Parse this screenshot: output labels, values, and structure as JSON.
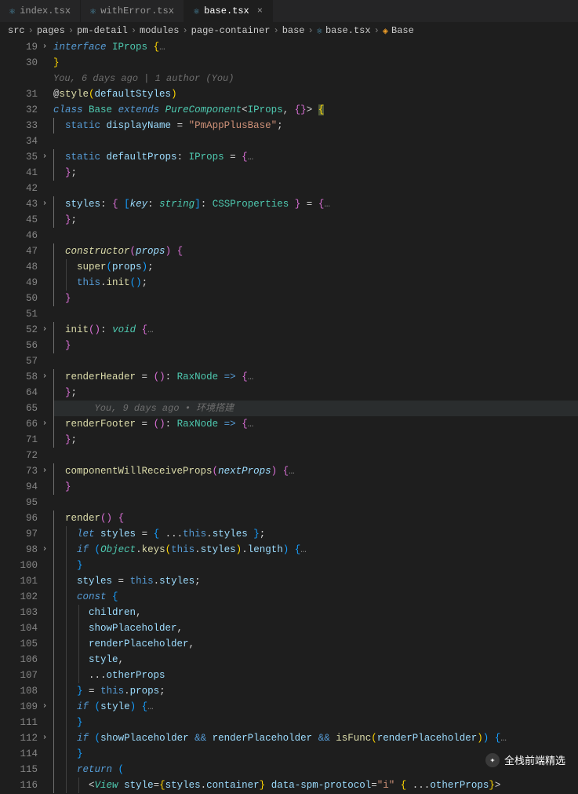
{
  "tabs": [
    {
      "label": "index.tsx",
      "active": false
    },
    {
      "label": "withError.tsx",
      "active": false
    },
    {
      "label": "base.tsx",
      "active": true
    }
  ],
  "breadcrumbs": {
    "parts": [
      "src",
      "pages",
      "pm-detail",
      "modules",
      "page-container",
      "base"
    ],
    "file": "base.tsx",
    "symbol": "Base"
  },
  "blame_top": "You, 6 days ago | 1 author (You)",
  "blame_line65": "You, 9 days ago • 环境搭建",
  "watermark": "全栈前端精选",
  "lines": {
    "l19": {
      "n": "19",
      "fold": true
    },
    "l30": {
      "n": "30"
    },
    "l31": {
      "n": "31"
    },
    "l32": {
      "n": "32"
    },
    "l33": {
      "n": "33"
    },
    "l34": {
      "n": "34"
    },
    "l35": {
      "n": "35",
      "fold": true
    },
    "l41": {
      "n": "41"
    },
    "l42": {
      "n": "42"
    },
    "l43": {
      "n": "43",
      "fold": true
    },
    "l45": {
      "n": "45"
    },
    "l46": {
      "n": "46"
    },
    "l47": {
      "n": "47",
      "bp": true
    },
    "l48": {
      "n": "48"
    },
    "l49": {
      "n": "49"
    },
    "l50": {
      "n": "50"
    },
    "l51": {
      "n": "51"
    },
    "l52": {
      "n": "52",
      "fold": true
    },
    "l56": {
      "n": "56"
    },
    "l57": {
      "n": "57"
    },
    "l58": {
      "n": "58",
      "fold": true
    },
    "l64": {
      "n": "64"
    },
    "l65": {
      "n": "65"
    },
    "l66": {
      "n": "66",
      "fold": true
    },
    "l71": {
      "n": "71"
    },
    "l72": {
      "n": "72"
    },
    "l73": {
      "n": "73",
      "fold": true,
      "bp": true
    },
    "l94": {
      "n": "94"
    },
    "l95": {
      "n": "95"
    },
    "l96": {
      "n": "96"
    },
    "l97": {
      "n": "97"
    },
    "l98": {
      "n": "98",
      "fold": true
    },
    "l100": {
      "n": "100"
    },
    "l101": {
      "n": "101"
    },
    "l102": {
      "n": "102"
    },
    "l103": {
      "n": "103"
    },
    "l104": {
      "n": "104"
    },
    "l105": {
      "n": "105"
    },
    "l106": {
      "n": "106"
    },
    "l107": {
      "n": "107"
    },
    "l108": {
      "n": "108"
    },
    "l109": {
      "n": "109",
      "fold": true
    },
    "l111": {
      "n": "111"
    },
    "l112": {
      "n": "112",
      "fold": true
    },
    "l114": {
      "n": "114"
    },
    "l115": {
      "n": "115"
    },
    "l116": {
      "n": "116"
    }
  },
  "code": {
    "interface": "interface",
    "IProps": "IProps",
    "style_dec": "style",
    "defaultStyles": "defaultStyles",
    "class": "class",
    "Base": "Base",
    "extends": "extends",
    "PureComponent": "PureComponent",
    "static": "static",
    "displayName": "displayName",
    "displayNameVal": "\"PmAppPlusBase\"",
    "defaultProps": "defaultProps",
    "styles": "styles",
    "key": "key",
    "string": "string",
    "CSSProperties": "CSSProperties",
    "constructor": "constructor",
    "props": "props",
    "super": "super",
    "this": "this",
    "init": "init",
    "void": "void",
    "renderHeader": "renderHeader",
    "RaxNode": "RaxNode",
    "renderFooter": "renderFooter",
    "componentWillReceiveProps": "componentWillReceiveProps",
    "nextProps": "nextProps",
    "render": "render",
    "let": "let",
    "if": "if",
    "Object": "Object",
    "keys": "keys",
    "length": "length",
    "const": "const",
    "children": "children",
    "showPlaceholder": "showPlaceholder",
    "renderPlaceholder": "renderPlaceholder",
    "style_var": "style",
    "otherProps": "otherProps",
    "isFunc": "isFunc",
    "return": "return",
    "View": "View",
    "container": "container",
    "dataSpm": "data-spm-protocol",
    "i": "\"i\""
  }
}
